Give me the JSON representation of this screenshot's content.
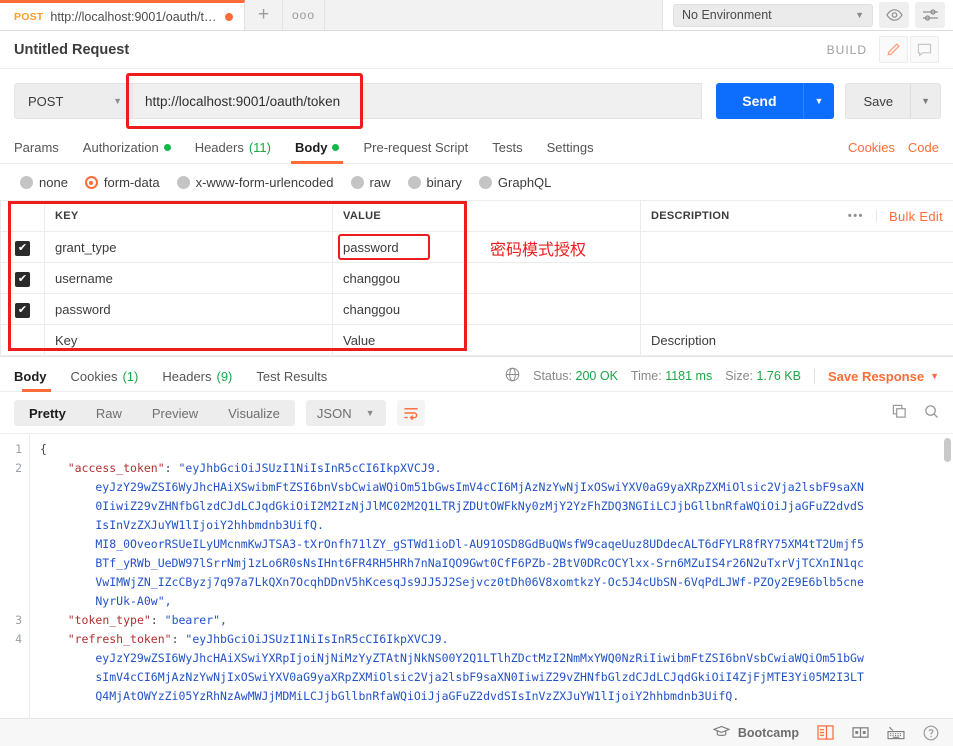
{
  "tabstrip": {
    "request_tab": {
      "method": "POST",
      "url": "http://localhost:9001/oauth/to...",
      "unsaved_icon": "unsaved-dot"
    },
    "new_tab_icon": "plus-icon",
    "more_tabs_icon": "ellipsis-icon",
    "environment": {
      "selected": "No Environment",
      "caret_icon": "chevron-down-icon"
    },
    "eye_icon": "eye-icon",
    "settings_icon": "sliders-icon"
  },
  "title_row": {
    "title": "Untitled Request",
    "build_label": "BUILD",
    "edit_icon": "pencil-icon",
    "comment_icon": "comment-icon"
  },
  "url_row": {
    "method": "POST",
    "method_caret_icon": "chevron-down-icon",
    "url": "http://localhost:9001/oauth/token",
    "send_label": "Send",
    "send_caret_icon": "chevron-down-icon",
    "save_label": "Save",
    "save_caret_icon": "chevron-down-icon"
  },
  "request_tabs": [
    {
      "label": "Params",
      "active": false,
      "dot": false,
      "count": ""
    },
    {
      "label": "Authorization",
      "active": false,
      "dot": true,
      "count": ""
    },
    {
      "label": "Headers",
      "active": false,
      "dot": false,
      "count": "(11)"
    },
    {
      "label": "Body",
      "active": true,
      "dot": true,
      "count": ""
    },
    {
      "label": "Pre-request Script",
      "active": false,
      "dot": false,
      "count": ""
    },
    {
      "label": "Tests",
      "active": false,
      "dot": false,
      "count": ""
    },
    {
      "label": "Settings",
      "active": false,
      "dot": false,
      "count": ""
    }
  ],
  "request_tabs_right": [
    {
      "label": "Cookies"
    },
    {
      "label": "Code"
    }
  ],
  "body_types": [
    {
      "label": "none",
      "selected": false
    },
    {
      "label": "form-data",
      "selected": true
    },
    {
      "label": "x-www-form-urlencoded",
      "selected": false
    },
    {
      "label": "raw",
      "selected": false
    },
    {
      "label": "binary",
      "selected": false
    },
    {
      "label": "GraphQL",
      "selected": false
    }
  ],
  "form_table": {
    "headers": {
      "key": "KEY",
      "value": "VALUE",
      "description": "DESCRIPTION"
    },
    "more_icon": "ellipsis-icon",
    "bulk_edit": "Bulk Edit",
    "rows": [
      {
        "checked": true,
        "key": "grant_type",
        "value": "password",
        "description": ""
      },
      {
        "checked": true,
        "key": "username",
        "value": "changgou",
        "description": ""
      },
      {
        "checked": true,
        "key": "password",
        "value": "changgou",
        "description": ""
      }
    ],
    "placeholder_row": {
      "key": "Key",
      "value": "Value",
      "description": "Description"
    },
    "annotation_note": "密码模式授权"
  },
  "response": {
    "tabs": [
      {
        "label": "Body",
        "active": true,
        "count": ""
      },
      {
        "label": "Cookies",
        "active": false,
        "count": "(1)"
      },
      {
        "label": "Headers",
        "active": false,
        "count": "(9)"
      },
      {
        "label": "Test Results",
        "active": false,
        "count": ""
      }
    ],
    "globe_icon": "globe-icon",
    "status_label": "Status:",
    "status_value": "200 OK",
    "time_label": "Time:",
    "time_value": "1181 ms",
    "size_label": "Size:",
    "size_value": "1.76 KB",
    "save_response": "Save Response",
    "save_response_caret_icon": "chevron-down-icon",
    "views": [
      {
        "label": "Pretty",
        "active": true
      },
      {
        "label": "Raw",
        "active": false
      },
      {
        "label": "Preview",
        "active": false
      },
      {
        "label": "Visualize",
        "active": false
      }
    ],
    "format": "JSON",
    "format_caret_icon": "chevron-down-icon",
    "wrap_icon": "word-wrap-icon",
    "copy_icon": "copy-icon",
    "search_icon": "search-icon",
    "line_numbers": [
      "1",
      "2",
      "3",
      "4"
    ],
    "json_lines": [
      "{",
      "    \"access_token\": \"eyJhbGciOiJSUzI1NiIsInR5cCI6IkpXVCJ9.",
      "        eyJzY29wZSI6WyJhcHAiXSwibmFtZSI6bnVsbCwiaWQiOm51bGwsImV4cCI6MjAzNzYwNjIxOSwiYXV0aG9yaXRpZXMiOlsic2Vja2lsbF9saXN",
      "        0IiwiZ29vZHNfbGlzdCJdLCJqdGkiOiI2M2IzNjJlMC02M2Q1LTRjZDUtOWFkNy0zMjY2YzFhZDQ3NGIiLCJjbGllbnRfaWQiOiJjaGFuZ2dvdS",
      "        IsInVzZXJuYW1lIjoiY2hhbmdnb3UifQ.",
      "        MI8_0OveorRSUeILyUMcnmKwJTSA3-tXrOnfh71lZY_gSTWd1ioDl-AU91OSD8GdBuQWsfW9caqeUuz8UDdecALT6dFYLR8fRY75XM4tT2Umjf5",
      "        BTf_yRWb_UeDW97lSrrNmj1zLo6R0sNsIHnt6FR4RH5HRh7nNaIQO9Gwt0CfF6PZb-2BtV0DRcOCYlxx-Srn6MZuIS4r26N2uTxrVjTCXnIN1qc",
      "        VwIMWjZN_IZcCByzj7q97a7LkQXn7OcqhDDnV5hKcesqJs9JJ5J2Sejvcz0tDh06V8xomtkzY-Oc5J4cUbSN-6VqPdLJWf-PZOy2E9E6blb5cne",
      "        NyrUk-A0w\",",
      "    \"token_type\": \"bearer\",",
      "    \"refresh_token\": \"eyJhbGciOiJSUzI1NiIsInR5cCI6IkpXVCJ9.",
      "        eyJzY29wZSI6WyJhcHAiXSwiYXRpIjoiNjNiMzYyZTAtNjNkNS00Y2Q1LTlhZDctMzI2NmMxYWQ0NzRiIiwibmFtZSI6bnVsbCwiaWQiOm51bGw",
      "        sImV4cCI6MjAzNzYwNjIxOSwiYXV0aG9yaXRpZXMiOlsic2Vja2lsbF9saXN0IiwiZ29vZHNfbGlzdCJdLCJqdGkiOiI4ZjFjMTE3Yi05M2I3LT",
      "        Q4MjAtOWYzZi05YzRhNzAwMWJjMDMiLCJjbGllbnRfaWQiOiJjaGFuZ2dvdSIsInVzZXJuYW1lIjoiY2hhbmdnb3UifQ."
    ]
  },
  "statusbar": {
    "bootcamp_icon": "graduation-cap-icon",
    "bootcamp_label": "Bootcamp",
    "two_pane_icon": "two-pane-layout-icon",
    "split_icon": "split-layout-icon",
    "keyboard_icon": "keyboard-icon",
    "help_icon": "help-circle-icon"
  },
  "colors": {
    "accent": "#ff6c37",
    "send_blue": "#0d6efd",
    "status_green": "#1aa845",
    "annotation_red": "#ee1c1c",
    "json_blue": "#2252c7"
  }
}
